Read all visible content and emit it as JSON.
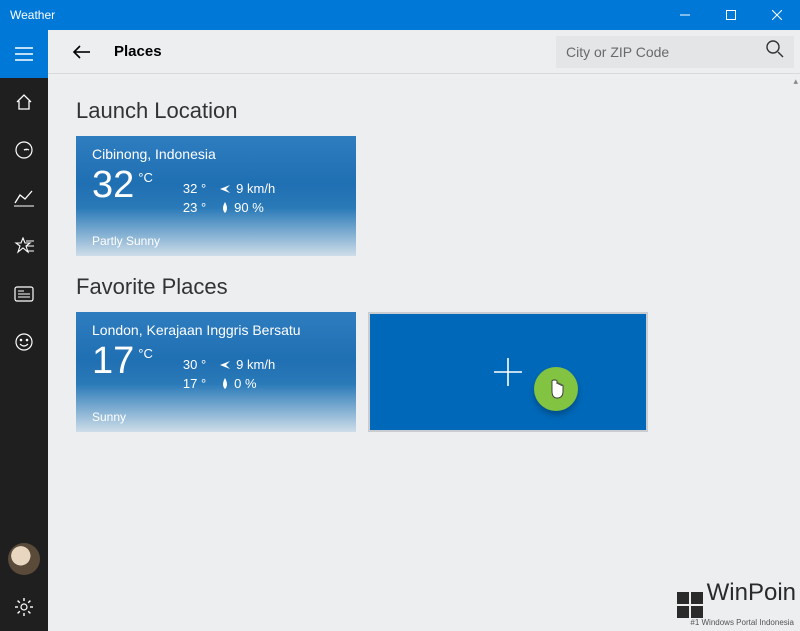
{
  "window": {
    "title": "Weather"
  },
  "header": {
    "page_title": "Places",
    "search_placeholder": "City or ZIP Code"
  },
  "sections": {
    "launch": {
      "title": "Launch Location",
      "tile": {
        "location": "Cibinong, Indonesia",
        "temp": "32",
        "unit": "°C",
        "high": "32 °",
        "low": "23 °",
        "wind": "9 km/h",
        "humidity": "90 %",
        "condition": "Partly Sunny"
      }
    },
    "favorites": {
      "title": "Favorite Places",
      "tiles": [
        {
          "location": "London, Kerajaan Inggris Bersatu",
          "temp": "17",
          "unit": "°C",
          "high": "30 °",
          "low": "17 °",
          "wind": "9 km/h",
          "humidity": "0 %",
          "condition": "Sunny"
        }
      ]
    }
  },
  "icons": {
    "home": "home",
    "radar": "radar",
    "charts": "charts",
    "places": "places",
    "news": "news",
    "feedback": "feedback",
    "settings": "settings"
  },
  "watermark": {
    "name": "WinPoin",
    "tagline": "#1 Windows Portal Indonesia"
  },
  "colors": {
    "accent": "#0078d7",
    "tile": "#0068b8",
    "badge": "#82c341"
  }
}
